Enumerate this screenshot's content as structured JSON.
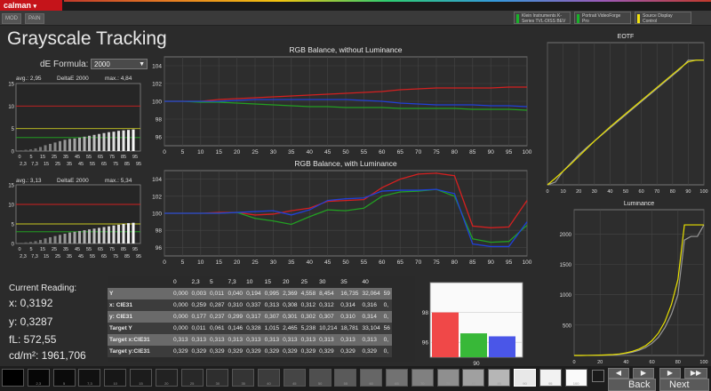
{
  "app": {
    "logo": "calman"
  },
  "menu_tabs": [
    "MOD",
    "PAIN"
  ],
  "devices": [
    {
      "label": "Klein Instruments K-Series\nTVL-DISS BEV",
      "color": "#19b12a"
    },
    {
      "label": "Portrait VideoForge Pro\n",
      "color": "#19b12a"
    },
    {
      "label": "Source Display Control\n",
      "color": "#f2e20f"
    }
  ],
  "page_title": "Grayscale Tracking",
  "de_formula": {
    "label": "dE Formula:",
    "value": "2000"
  },
  "de_chart1": {
    "avg": "avg.: 2,95",
    "label": "DeltaE 2000",
    "max": "max.: 4,84",
    "bars": [
      0.2,
      0.3,
      0.4,
      0.6,
      0.9,
      1.3,
      1.6,
      1.9,
      2.2,
      2.5,
      2.7,
      2.8,
      3.0,
      3.2,
      3.4,
      3.6,
      3.8,
      4.0,
      4.2,
      4.3,
      4.5,
      4.6,
      4.7,
      4.8
    ]
  },
  "de_chart2": {
    "avg": "avg.: 3,13",
    "label": "DeltaE 2000",
    "max": "max.: 5,34",
    "bars": [
      0.2,
      0.3,
      0.4,
      0.6,
      0.9,
      1.3,
      1.6,
      1.9,
      2.2,
      2.5,
      2.8,
      3.0,
      3.2,
      3.4,
      3.6,
      3.8,
      4.0,
      4.2,
      4.4,
      4.6,
      4.8,
      5.0,
      5.2,
      5.3
    ]
  },
  "de_axis": {
    "y": [
      "15",
      "10",
      "5",
      "0"
    ],
    "x_top": [
      "0",
      "5",
      "15",
      "25",
      "35",
      "45",
      "55",
      "65",
      "75",
      "85",
      "95"
    ],
    "x_bot": [
      "2,3",
      "7,3",
      "15",
      "25",
      "35",
      "45",
      "55",
      "65",
      "75",
      "85",
      "95"
    ]
  },
  "chart_data": [
    {
      "type": "line",
      "title": "RGB Balance, without Luminance",
      "xlim": [
        0,
        100
      ],
      "ylim": [
        95,
        105
      ],
      "yticks": [
        "104",
        "102",
        "100",
        "98",
        "96"
      ],
      "x": [
        0,
        5,
        10,
        15,
        20,
        25,
        30,
        35,
        40,
        45,
        50,
        55,
        60,
        65,
        70,
        75,
        80,
        85,
        90,
        95,
        100
      ],
      "series": [
        {
          "color": "#d42020",
          "values": [
            100,
            100,
            100,
            100.2,
            100.3,
            100.4,
            100.5,
            100.6,
            100.7,
            100.8,
            100.9,
            101.0,
            101.1,
            101.3,
            101.4,
            101.5,
            101.5,
            101.5,
            101.5,
            101.6,
            101.6
          ]
        },
        {
          "color": "#22a022",
          "values": [
            100,
            100,
            99.9,
            99.9,
            99.8,
            99.7,
            99.6,
            99.5,
            99.4,
            99.4,
            99.3,
            99.3,
            99.3,
            99.2,
            99.2,
            99.2,
            99.2,
            99.1,
            99.1,
            99.1,
            99.0
          ]
        },
        {
          "color": "#2040d8",
          "values": [
            100,
            100,
            100,
            100,
            100.1,
            100.2,
            100.2,
            100.2,
            100.2,
            100.2,
            100.2,
            100.1,
            100.0,
            99.8,
            99.7,
            99.6,
            99.6,
            99.6,
            99.5,
            99.5,
            99.4
          ]
        }
      ]
    },
    {
      "type": "line",
      "title": "RGB Balance, with Luminance",
      "xlim": [
        0,
        100
      ],
      "ylim": [
        95,
        105
      ],
      "yticks": [
        "104",
        "102",
        "100",
        "98",
        "96"
      ],
      "x": [
        0,
        5,
        10,
        15,
        20,
        25,
        30,
        35,
        40,
        45,
        50,
        55,
        60,
        65,
        70,
        75,
        80,
        85,
        90,
        95,
        100
      ],
      "series": [
        {
          "color": "#d42020",
          "values": [
            100,
            100,
            100,
            100.1,
            100.1,
            99.8,
            99.9,
            100.3,
            100.6,
            101.4,
            101.5,
            101.6,
            103.0,
            104.0,
            104.6,
            104.7,
            104.4,
            98.5,
            98.3,
            98.4,
            101.5
          ]
        },
        {
          "color": "#22a022",
          "values": [
            100,
            100,
            100,
            100,
            100.1,
            99.4,
            99.1,
            98.7,
            99.6,
            100.4,
            100.3,
            100.6,
            102.0,
            102.5,
            102.6,
            102.8,
            102.0,
            97.0,
            96.6,
            96.7,
            98.6
          ]
        },
        {
          "color": "#2040d8",
          "values": [
            100,
            100,
            100,
            100,
            100.1,
            100.2,
            100.3,
            99.8,
            100.4,
            101.5,
            101.7,
            101.8,
            102.6,
            102.7,
            102.7,
            102.8,
            102.3,
            96.4,
            96.1,
            96.1,
            99.0
          ]
        }
      ]
    },
    {
      "type": "line",
      "title": "EOTF",
      "xlim": [
        0,
        100
      ],
      "ylim": [
        0,
        2.6
      ],
      "x": [
        0,
        5,
        10,
        15,
        20,
        25,
        30,
        35,
        40,
        45,
        50,
        55,
        60,
        65,
        70,
        75,
        80,
        85,
        90,
        95,
        100
      ],
      "series": [
        {
          "color": "#999999",
          "values": [
            0,
            0.05,
            0.25,
            0.4,
            0.55,
            0.68,
            0.8,
            0.92,
            1.04,
            1.16,
            1.28,
            1.4,
            1.52,
            1.64,
            1.76,
            1.88,
            2.0,
            2.12,
            2.28,
            2.28,
            2.28
          ]
        },
        {
          "color": "#e8e000",
          "values": [
            0,
            0.12,
            0.25,
            0.38,
            0.52,
            0.66,
            0.8,
            0.93,
            1.06,
            1.18,
            1.3,
            1.42,
            1.54,
            1.66,
            1.78,
            1.9,
            2.02,
            2.14,
            2.25,
            2.28,
            2.28
          ]
        }
      ]
    },
    {
      "type": "line",
      "title": "Luminance",
      "xlim": [
        0,
        100
      ],
      "ylim": [
        0,
        2400
      ],
      "yticks": [
        "2000",
        "1500",
        "1000",
        "500"
      ],
      "x": [
        0,
        5,
        10,
        15,
        20,
        25,
        30,
        35,
        40,
        45,
        50,
        55,
        60,
        65,
        70,
        75,
        80,
        85,
        90,
        95,
        100
      ],
      "series": [
        {
          "color": "#999999",
          "values": [
            0,
            0,
            1,
            2,
            4,
            7,
            12,
            20,
            34,
            55,
            85,
            130,
            200,
            300,
            460,
            680,
            1000,
            1900,
            1960,
            1960,
            2150
          ]
        },
        {
          "color": "#e8e000",
          "values": [
            0,
            0,
            1,
            3,
            5,
            9,
            15,
            25,
            42,
            68,
            105,
            160,
            245,
            370,
            560,
            840,
            1250,
            2150,
            2150,
            2150,
            2150
          ]
        }
      ]
    },
    {
      "type": "bar",
      "categories": [
        "R",
        "G",
        "B"
      ],
      "values": [
        98.0,
        96.6,
        96.4
      ],
      "colors": [
        "#f04848",
        "#38b838",
        "#4a56e8"
      ],
      "ylim": [
        95,
        100
      ],
      "yticks": [
        "98",
        "96"
      ],
      "xlabel": "90"
    }
  ],
  "table": {
    "header": [
      "0",
      "2,3",
      "5",
      "7,3",
      "10",
      "15",
      "20",
      "25",
      "30",
      "35",
      "40"
    ],
    "rows": [
      {
        "label": "Y",
        "vals": [
          "0,000",
          "0,003",
          "0,011",
          "0,040",
          "0,194",
          "0,995",
          "2,369",
          "4,558",
          "8,454",
          "16,735",
          "32,064",
          "59"
        ]
      },
      {
        "label": "x: CIE31",
        "vals": [
          "0,000",
          "0,259",
          "0,287",
          "0,310",
          "0,337",
          "0,313",
          "0,308",
          "0,312",
          "0,312",
          "0,314",
          "0,316",
          "0,"
        ]
      },
      {
        "label": "y: CIE31",
        "vals": [
          "0,000",
          "0,177",
          "0,237",
          "0,299",
          "0,317",
          "0,307",
          "0,301",
          "0,302",
          "0,307",
          "0,310",
          "0,314",
          "0,"
        ]
      },
      {
        "label": "Target Y",
        "vals": [
          "0,000",
          "0,011",
          "0,061",
          "0,146",
          "0,328",
          "1,015",
          "2,465",
          "5,238",
          "10,214",
          "18,781",
          "33,104",
          "56"
        ]
      },
      {
        "label": "Target x:CIE31",
        "vals": [
          "0,313",
          "0,313",
          "0,313",
          "0,313",
          "0,313",
          "0,313",
          "0,313",
          "0,313",
          "0,313",
          "0,313",
          "0,313",
          "0,"
        ]
      },
      {
        "label": "Target y:CIE31",
        "vals": [
          "0,329",
          "0,329",
          "0,329",
          "0,329",
          "0,329",
          "0,329",
          "0,329",
          "0,329",
          "0,329",
          "0,329",
          "0,329",
          "0,"
        ]
      }
    ]
  },
  "reading": {
    "heading": "Current Reading:",
    "x": "x: 0,3192",
    "y": "y: 0,3287",
    "fl": "fL: 572,55",
    "cd": "cd/m²: 1961,706"
  },
  "swatches": [
    {
      "color": "#000000",
      "label": ""
    },
    {
      "color": "#060606",
      "label": "2,3"
    },
    {
      "color": "#0b0b0b",
      "label": "5"
    },
    {
      "color": "#111111",
      "label": "7,3"
    },
    {
      "color": "#171717",
      "label": "10"
    },
    {
      "color": "#1c1c1c",
      "label": "15"
    },
    {
      "color": "#222222",
      "label": "20"
    },
    {
      "color": "#282828",
      "label": "25"
    },
    {
      "color": "#2e2e2e",
      "label": "30"
    },
    {
      "color": "#343434",
      "label": "35"
    },
    {
      "color": "#3c3c3c",
      "label": "40"
    },
    {
      "color": "#454545",
      "label": "45"
    },
    {
      "color": "#4f4f4f",
      "label": "50"
    },
    {
      "color": "#5a5a5a",
      "label": "55"
    },
    {
      "color": "#666666",
      "label": "60"
    },
    {
      "color": "#727272",
      "label": "65"
    },
    {
      "color": "#808080",
      "label": "70"
    },
    {
      "color": "#8f8f8f",
      "label": "75"
    },
    {
      "color": "#a0a0a0",
      "label": "80"
    },
    {
      "color": "#b6b6b6",
      "label": "85"
    },
    {
      "color": "#e8e8e8",
      "label": "90"
    },
    {
      "color": "#f2f2f2",
      "label": "95"
    },
    {
      "color": "#fafafa",
      "label": "100"
    }
  ],
  "nav": {
    "back": "Back",
    "next": "Next"
  }
}
